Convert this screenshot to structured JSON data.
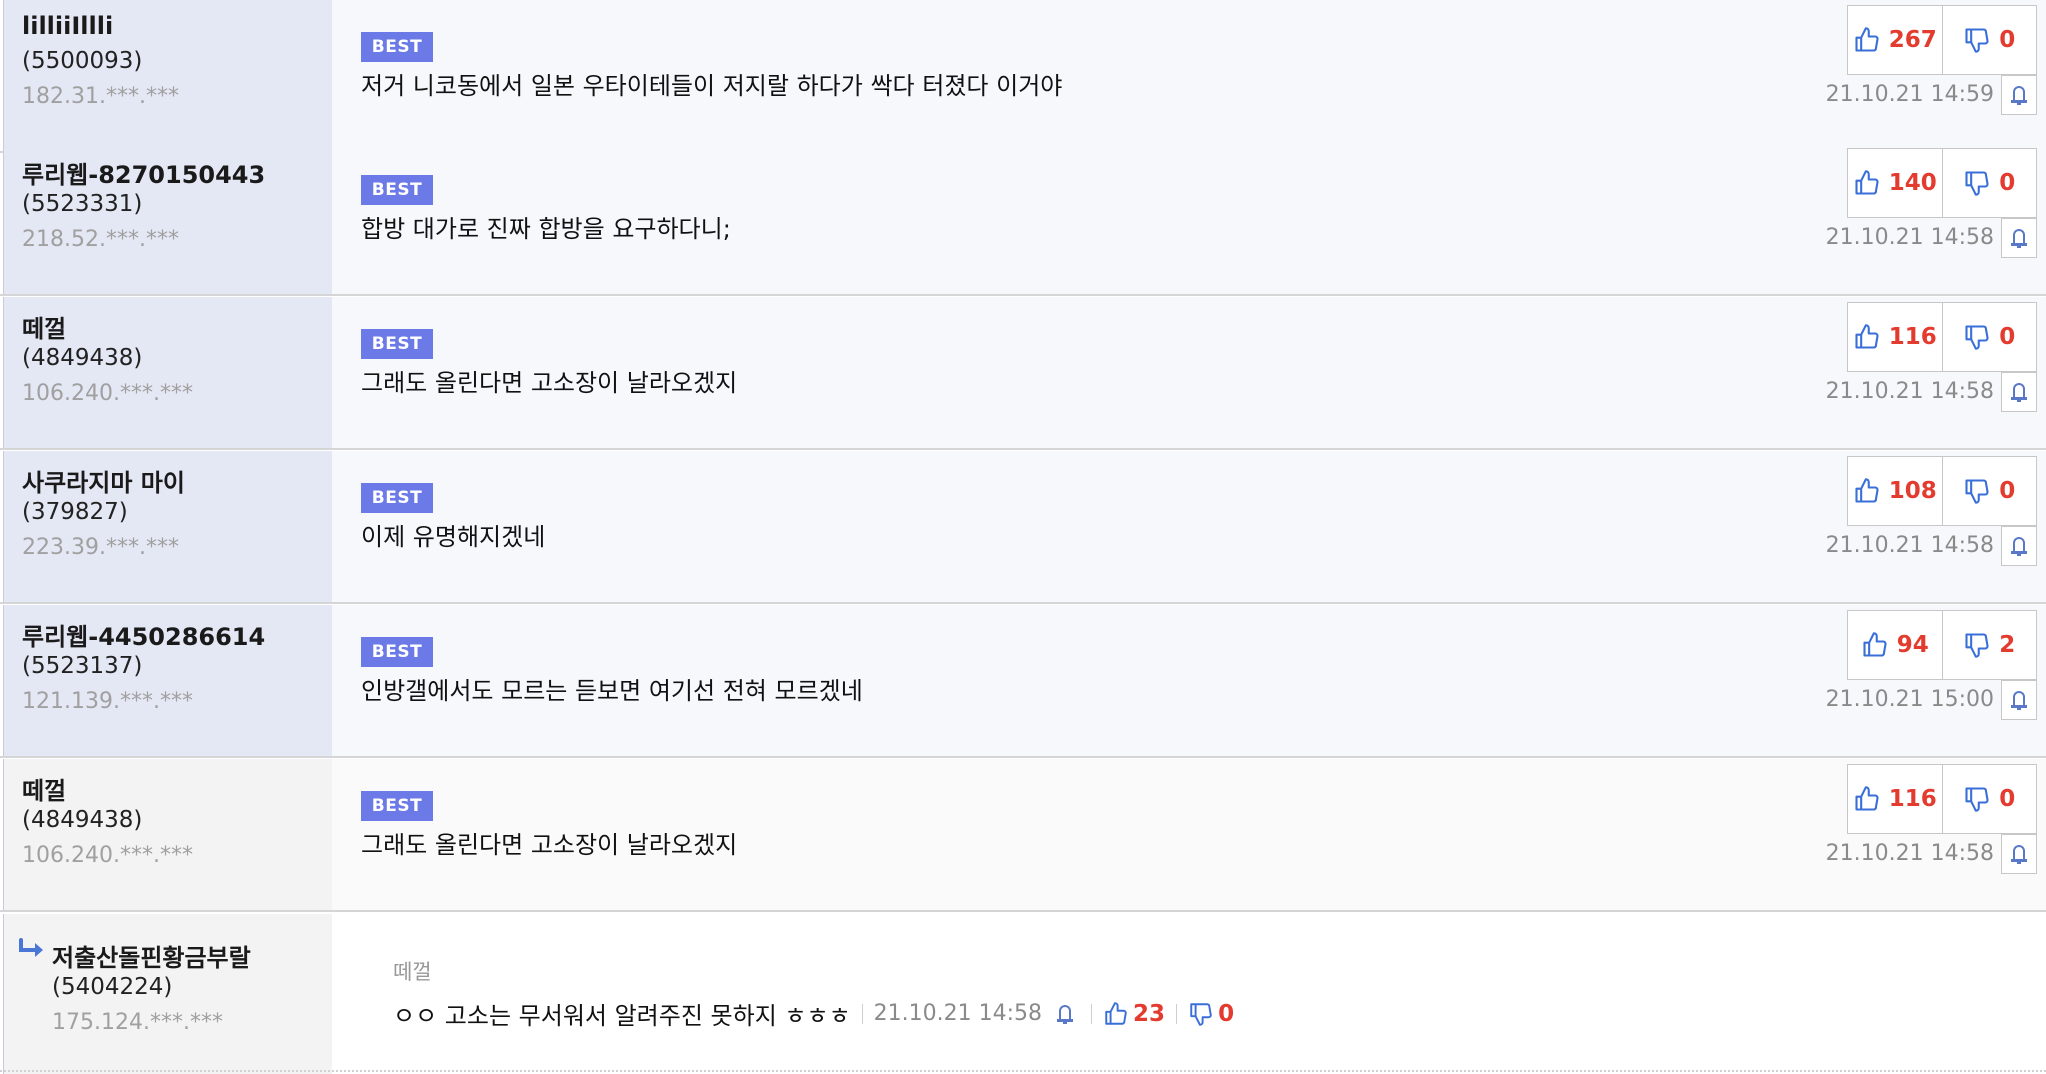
{
  "comments": [
    {
      "nick": "lilliiIllli",
      "uid": "(5500093)",
      "ip": "182.31.***.***",
      "badge": "BEST",
      "text": "저거 니코동에서 일본 우타이테들이 저지랄 하다가 싹다 터졌다 이거야",
      "up": "267",
      "down": "0",
      "date": "21.10.21 14:59"
    },
    {
      "nick": "루리웹-8270150443",
      "uid": "(5523331)",
      "ip": "218.52.***.***",
      "badge": "BEST",
      "text": "합방 대가로 진짜 합방을 요구하다니;",
      "up": "140",
      "down": "0",
      "date": "21.10.21 14:58"
    },
    {
      "nick": "떼껄",
      "uid": "(4849438)",
      "ip": "106.240.***.***",
      "badge": "BEST",
      "text": "그래도 올린다면 고소장이 날라오겠지",
      "up": "116",
      "down": "0",
      "date": "21.10.21 14:58"
    },
    {
      "nick": "사쿠라지마 마이",
      "uid": "(379827)",
      "ip": "223.39.***.***",
      "badge": "BEST",
      "text": "이제 유명해지겠네",
      "up": "108",
      "down": "0",
      "date": "21.10.21 14:58"
    },
    {
      "nick": "루리웹-4450286614",
      "uid": "(5523137)",
      "ip": "121.139.***.***",
      "badge": "BEST",
      "text": "인방갤에서도 모르는 듣보면 여기선 전혀 모르겠네",
      "up": "94",
      "down": "2",
      "date": "21.10.21 15:00"
    },
    {
      "nick": "떼껄",
      "uid": "(4849438)",
      "ip": "106.240.***.***",
      "badge": "BEST",
      "text": "그래도 올린다면 고소장이 날라오겠지",
      "up": "116",
      "down": "0",
      "date": "21.10.21 14:58"
    }
  ],
  "reply": {
    "nick": "저출산돌핀황금부랄",
    "uid": "(5404224)",
    "ip": "175.124.***.***",
    "parent_nick": "떼껄",
    "text": "ㅇㅇ 고소는 무서워서 알려주진 못하지 ㅎㅎㅎ",
    "date": "21.10.21 14:58",
    "up": "23",
    "down": "0"
  },
  "colors": {
    "badge": "#6b7ae6",
    "vote_count": "#e33b2e",
    "icon": "#3a6fd8",
    "author_bg_highlight": "#e4e7f4"
  }
}
